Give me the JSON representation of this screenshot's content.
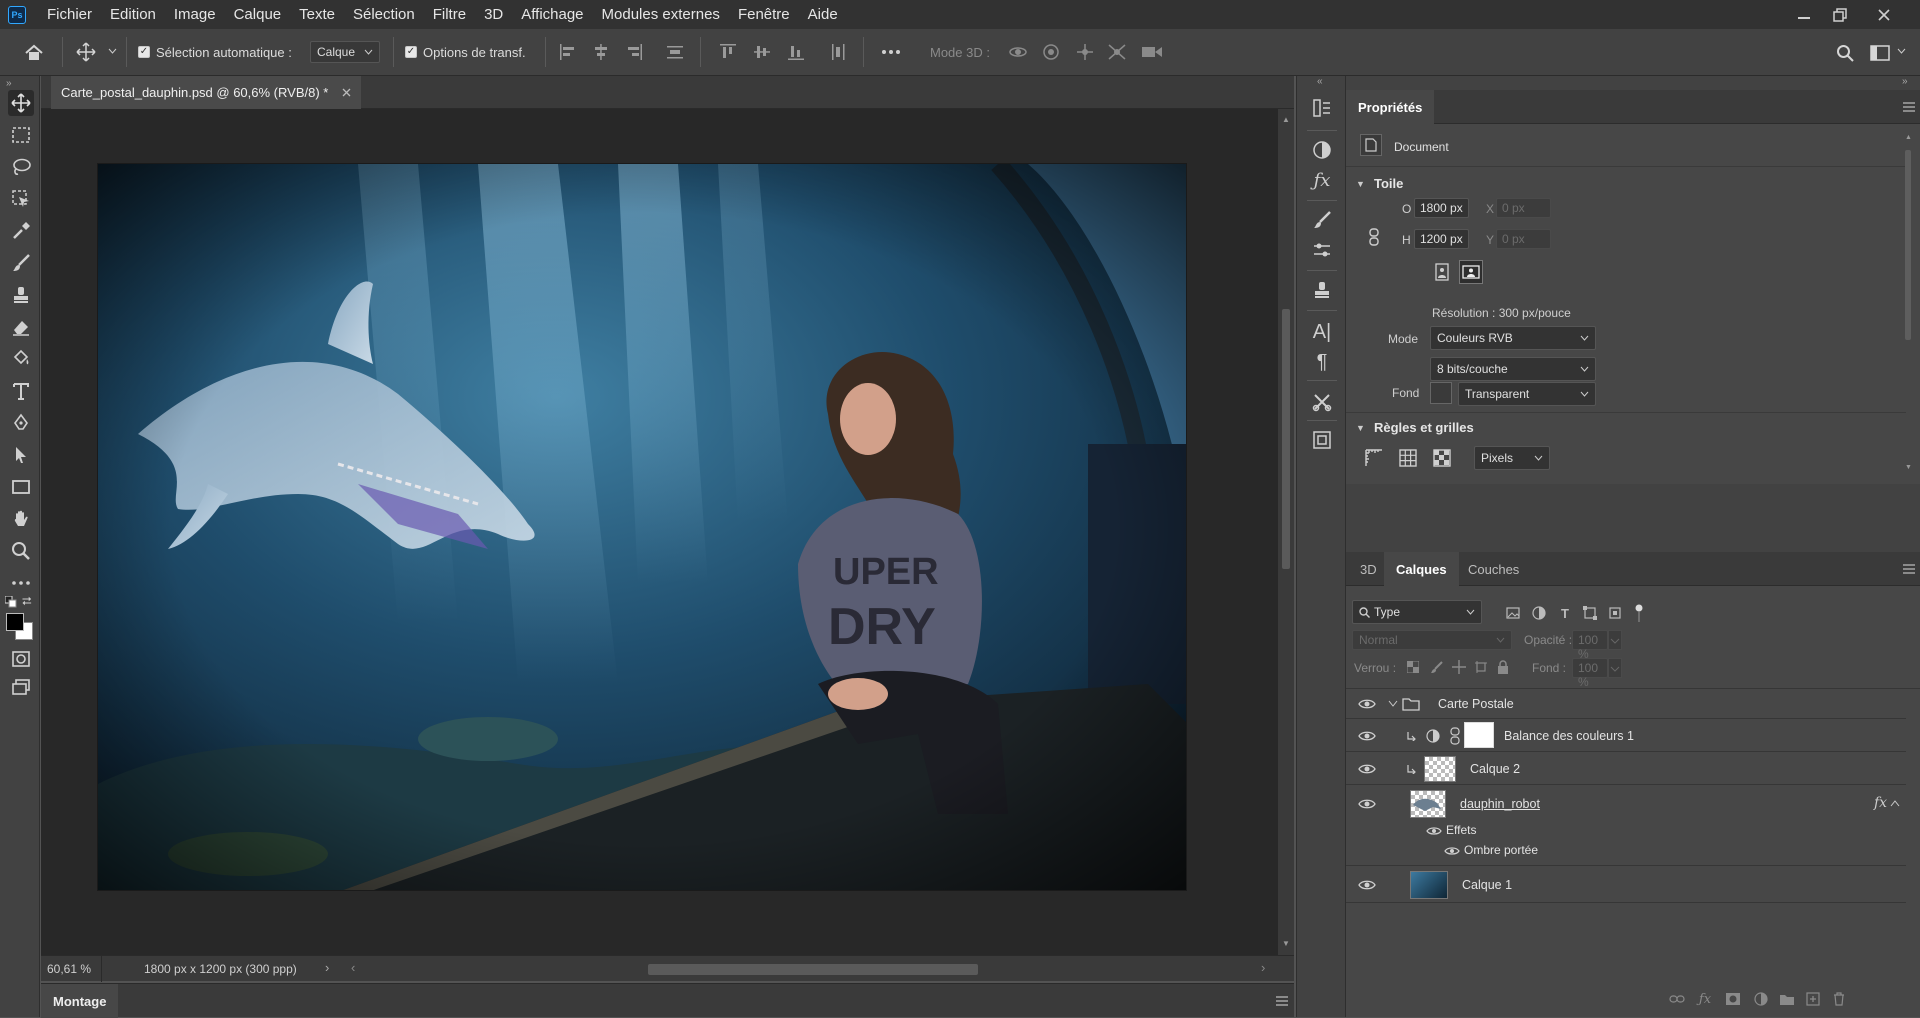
{
  "app": {
    "logo": "Ps"
  },
  "menu": [
    "Fichier",
    "Edition",
    "Image",
    "Calque",
    "Texte",
    "Sélection",
    "Filtre",
    "3D",
    "Affichage",
    "Modules externes",
    "Fenêtre",
    "Aide"
  ],
  "options": {
    "auto_select_label": "Sélection automatique :",
    "auto_select_value": "Calque",
    "transform_label": "Options de transf.",
    "mode3d_label": "Mode 3D :"
  },
  "document": {
    "tab_title": "Carte_postal_dauphin.psd @ 60,6% (RVB/8) *",
    "zoom": "60,61 %",
    "info": "1800 px x 1200 px (300 ppp)",
    "bottom_tab": "Montage"
  },
  "properties": {
    "title": "Propriétés",
    "doc_label": "Document",
    "canvas_section": "Toile",
    "width_label": "O",
    "width_value": "1800 px",
    "height_label": "H",
    "height_value": "1200 px",
    "x_label": "X",
    "x_placeholder": "0 px",
    "y_label": "Y",
    "y_placeholder": "0 px",
    "resolution": "Résolution : 300 px/pouce",
    "mode_label": "Mode",
    "mode_value": "Couleurs RVB",
    "bits_value": "8 bits/couche",
    "fill_label": "Fond",
    "fill_value": "Transparent",
    "rulers_section": "Règles et grilles",
    "units_value": "Pixels"
  },
  "layers_panel": {
    "tabs": [
      "3D",
      "Calques",
      "Couches"
    ],
    "filter_value": "Type",
    "blend_mode": "Normal",
    "opacity_label": "Opacité :",
    "opacity_value": "100 %",
    "lock_label": "Verrou :",
    "fill_label": "Fond :",
    "fill_value": "100 %",
    "layers": [
      {
        "name": "Carte Postale"
      },
      {
        "name": "Balance des couleurs 1"
      },
      {
        "name": "Calque 2"
      },
      {
        "name": "dauphin_robot",
        "fx": "fx"
      },
      {
        "name": "Effets"
      },
      {
        "name": "Ombre portée"
      },
      {
        "name": "Calque 1"
      }
    ]
  },
  "colors": {
    "accent": "#31a8ff",
    "panel": "#424242",
    "menubar": "#323232"
  }
}
